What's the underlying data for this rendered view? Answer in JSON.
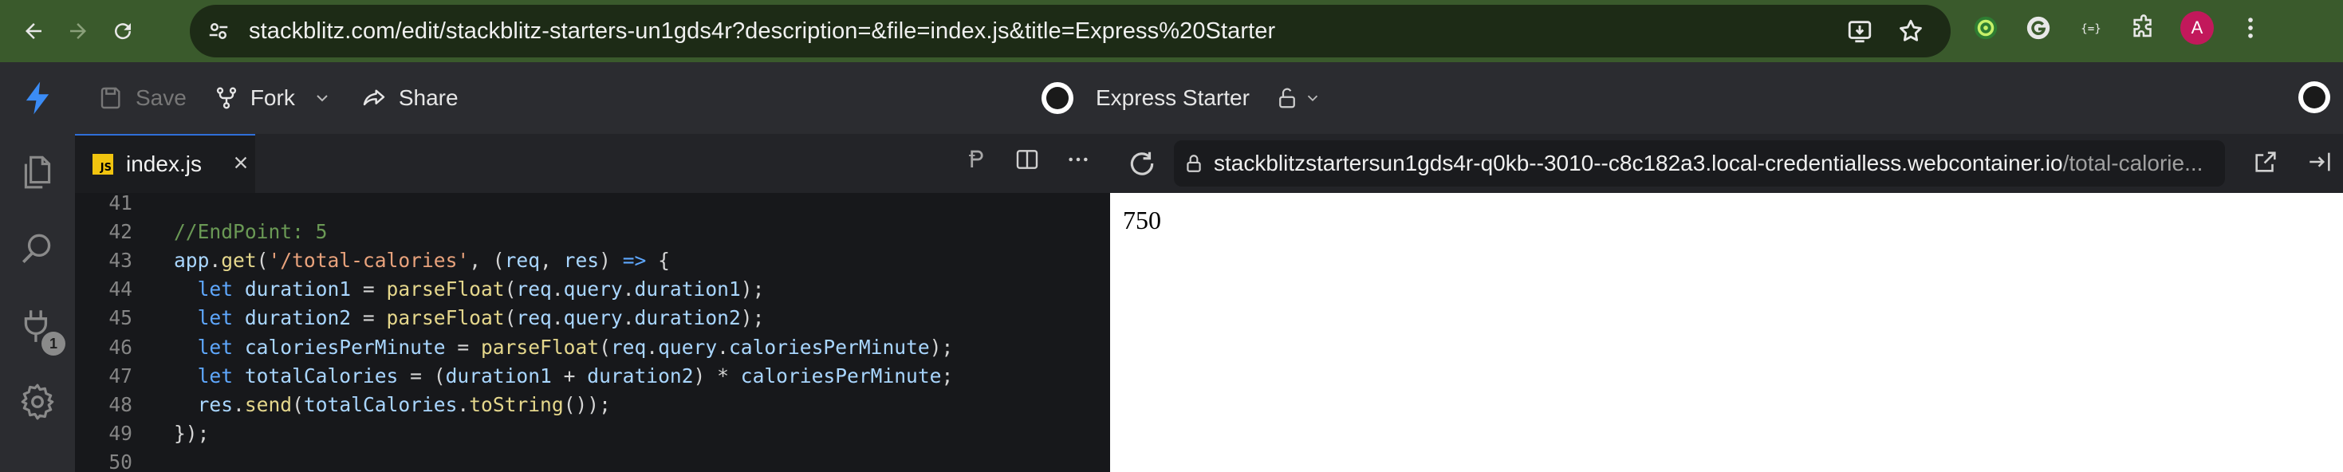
{
  "browser": {
    "url": "stackblitz.com/edit/stackblitz-starters-un1gds4r?description=&file=index.js&title=Express%20Starter",
    "profile_initial": "A"
  },
  "header": {
    "save_label": "Save",
    "fork_label": "Fork",
    "share_label": "Share",
    "project_title": "Express Starter"
  },
  "activity": {
    "badge_count": "1"
  },
  "editor": {
    "tab_label": "index.js",
    "tab_icon_text": "JS",
    "lines": [
      {
        "n": "41",
        "parts": []
      },
      {
        "n": "42",
        "parts": [
          {
            "t": "//EndPoint: 5",
            "c": "c-comment"
          }
        ]
      },
      {
        "n": "43",
        "parts": [
          {
            "t": "app",
            "c": "c-var"
          },
          {
            "t": ".",
            "c": ""
          },
          {
            "t": "get",
            "c": "c-fn"
          },
          {
            "t": "(",
            "c": ""
          },
          {
            "t": "'/total-calories'",
            "c": "c-str"
          },
          {
            "t": ", (",
            "c": ""
          },
          {
            "t": "req",
            "c": "c-var"
          },
          {
            "t": ", ",
            "c": ""
          },
          {
            "t": "res",
            "c": "c-var"
          },
          {
            "t": ") ",
            "c": ""
          },
          {
            "t": "=>",
            "c": "c-arrow"
          },
          {
            "t": " {",
            "c": ""
          }
        ]
      },
      {
        "n": "44",
        "parts": [
          {
            "t": "  let ",
            "c": "c-kw"
          },
          {
            "t": "duration1",
            "c": "c-var"
          },
          {
            "t": " = ",
            "c": ""
          },
          {
            "t": "parseFloat",
            "c": "c-fn"
          },
          {
            "t": "(",
            "c": ""
          },
          {
            "t": "req",
            "c": "c-var"
          },
          {
            "t": ".",
            "c": ""
          },
          {
            "t": "query",
            "c": "c-var"
          },
          {
            "t": ".",
            "c": ""
          },
          {
            "t": "duration1",
            "c": "c-var"
          },
          {
            "t": ");",
            "c": ""
          }
        ]
      },
      {
        "n": "45",
        "parts": [
          {
            "t": "  let ",
            "c": "c-kw"
          },
          {
            "t": "duration2",
            "c": "c-var"
          },
          {
            "t": " = ",
            "c": ""
          },
          {
            "t": "parseFloat",
            "c": "c-fn"
          },
          {
            "t": "(",
            "c": ""
          },
          {
            "t": "req",
            "c": "c-var"
          },
          {
            "t": ".",
            "c": ""
          },
          {
            "t": "query",
            "c": "c-var"
          },
          {
            "t": ".",
            "c": ""
          },
          {
            "t": "duration2",
            "c": "c-var"
          },
          {
            "t": ");",
            "c": ""
          }
        ]
      },
      {
        "n": "46",
        "parts": [
          {
            "t": "  let ",
            "c": "c-kw"
          },
          {
            "t": "caloriesPerMinute",
            "c": "c-var"
          },
          {
            "t": " = ",
            "c": ""
          },
          {
            "t": "parseFloat",
            "c": "c-fn"
          },
          {
            "t": "(",
            "c": ""
          },
          {
            "t": "req",
            "c": "c-var"
          },
          {
            "t": ".",
            "c": ""
          },
          {
            "t": "query",
            "c": "c-var"
          },
          {
            "t": ".",
            "c": ""
          },
          {
            "t": "caloriesPerMinute",
            "c": "c-var"
          },
          {
            "t": ");",
            "c": ""
          }
        ]
      },
      {
        "n": "47",
        "parts": [
          {
            "t": "  let ",
            "c": "c-kw"
          },
          {
            "t": "totalCalories",
            "c": "c-var"
          },
          {
            "t": " = (",
            "c": ""
          },
          {
            "t": "duration1",
            "c": "c-var"
          },
          {
            "t": " + ",
            "c": ""
          },
          {
            "t": "duration2",
            "c": "c-var"
          },
          {
            "t": ") * ",
            "c": ""
          },
          {
            "t": "caloriesPerMinute",
            "c": "c-var"
          },
          {
            "t": ";",
            "c": ""
          }
        ]
      },
      {
        "n": "48",
        "parts": [
          {
            "t": "  res",
            "c": "c-var"
          },
          {
            "t": ".",
            "c": ""
          },
          {
            "t": "send",
            "c": "c-fn"
          },
          {
            "t": "(",
            "c": ""
          },
          {
            "t": "totalCalories",
            "c": "c-var"
          },
          {
            "t": ".",
            "c": ""
          },
          {
            "t": "toString",
            "c": "c-fn"
          },
          {
            "t": "());",
            "c": ""
          }
        ]
      },
      {
        "n": "49",
        "parts": [
          {
            "t": "});",
            "c": ""
          }
        ]
      },
      {
        "n": "50",
        "parts": []
      }
    ]
  },
  "preview": {
    "url_host": "stackblitzstartersun1gds4r-q0kb--3010--c8c182a3.local-credentialless.webcontainer.io",
    "url_path": "/total-calorie...",
    "output_text": "750"
  }
}
